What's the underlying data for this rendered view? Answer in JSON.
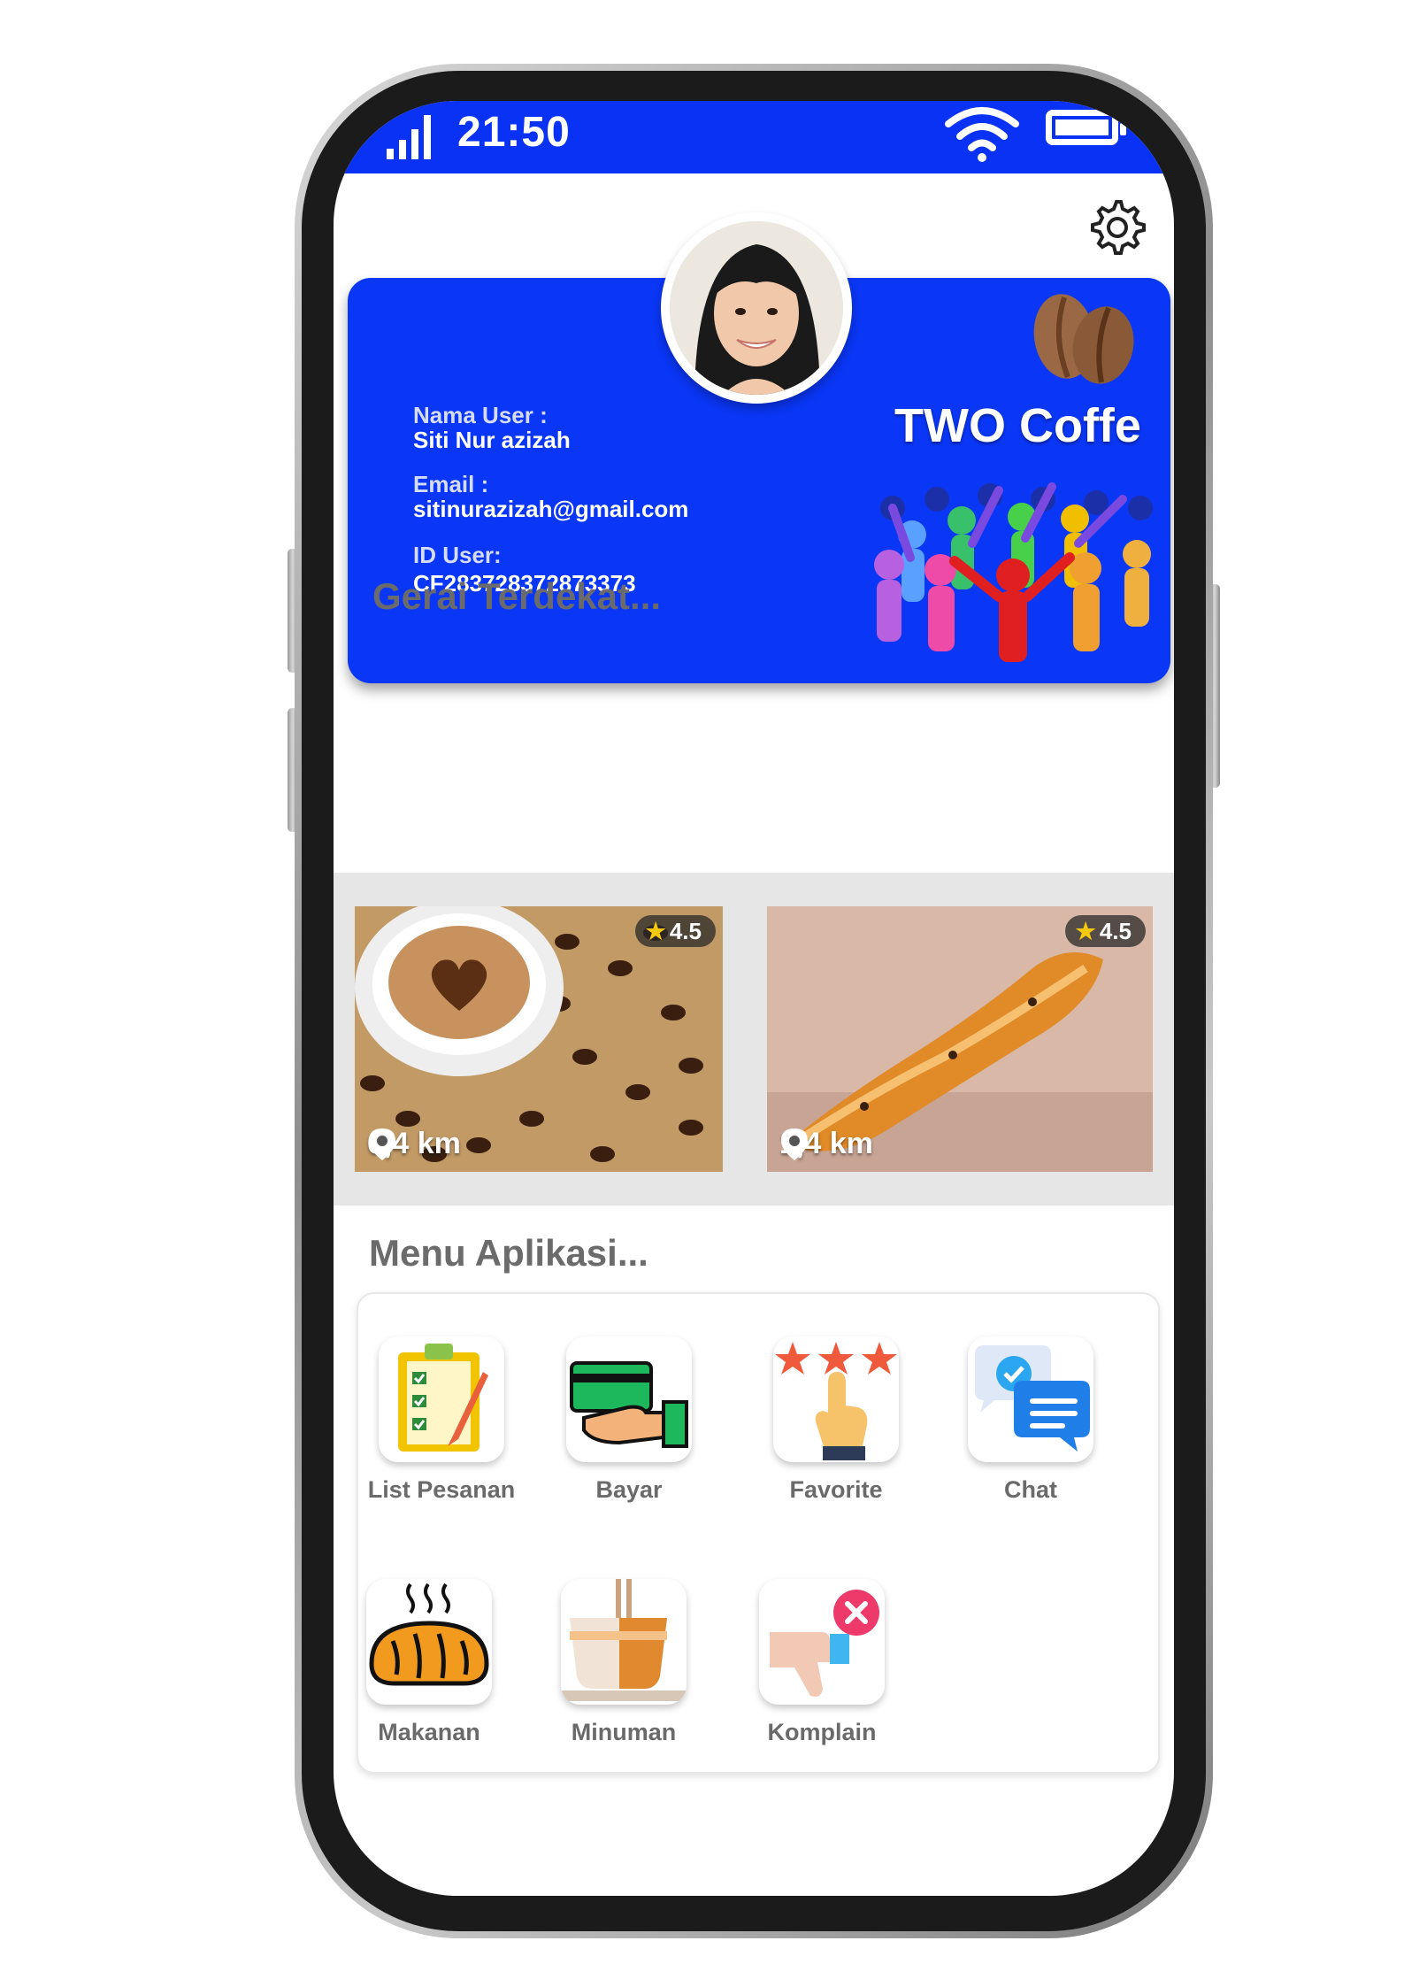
{
  "status_bar": {
    "time": "21:50"
  },
  "profile": {
    "name_label": "Nama User :",
    "name": "Siti Nur azizah",
    "email_label": "Email :",
    "email": "sitinurazizah@gmail.com",
    "id_label": "ID User:",
    "id": "CF283728372873373",
    "brand": "TWO Coffe"
  },
  "nearby": {
    "title": "Gerai Terdekat...",
    "stores": [
      {
        "rating": "4.5",
        "distance": "0,4 km"
      },
      {
        "rating": "4.5",
        "distance": "1,4 km"
      }
    ]
  },
  "menu": {
    "title": "Menu Aplikasi...",
    "items": [
      {
        "label": "List Pesanan",
        "icon": "checklist-icon"
      },
      {
        "label": "Bayar",
        "icon": "payment-icon"
      },
      {
        "label": "Favorite",
        "icon": "favorite-star-icon"
      },
      {
        "label": "Chat",
        "icon": "chat-icon"
      },
      {
        "label": "Makanan",
        "icon": "bread-icon"
      },
      {
        "label": "Minuman",
        "icon": "drink-icon"
      },
      {
        "label": "Komplain",
        "icon": "complaint-icon"
      }
    ]
  },
  "colors": {
    "primary": "#0a32f5",
    "heading": "#6b6b6b",
    "strip": "#e6e6e6",
    "rating_star": "#f6c90e"
  }
}
